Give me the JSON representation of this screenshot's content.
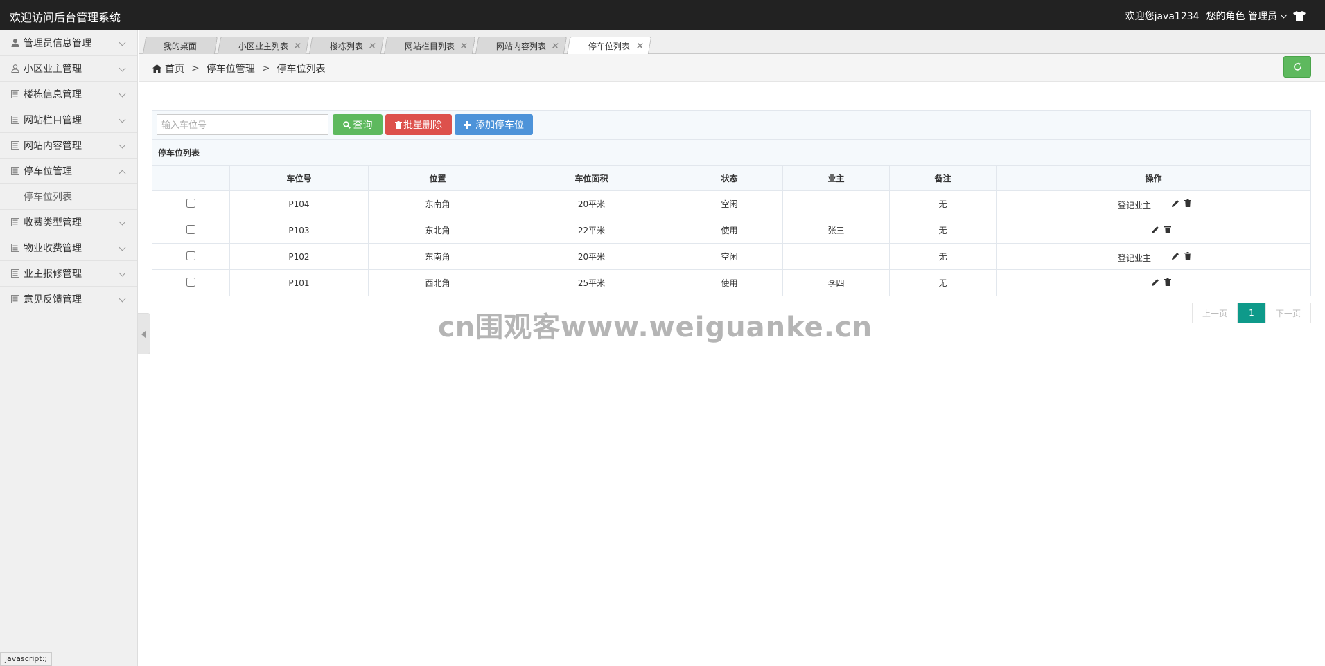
{
  "header": {
    "app_title": "欢迎访问后台管理系统",
    "welcome_user": "欢迎您java1234",
    "role_label": "您的角色 管理员"
  },
  "sidebar": {
    "items": [
      {
        "label": "管理员信息管理",
        "icon": "user-icon"
      },
      {
        "label": "小区业主管理",
        "icon": "user-outline-icon"
      },
      {
        "label": "楼栋信息管理",
        "icon": "list-icon"
      },
      {
        "label": "网站栏目管理",
        "icon": "list-icon"
      },
      {
        "label": "网站内容管理",
        "icon": "list-icon"
      },
      {
        "label": "停车位管理",
        "icon": "list-icon",
        "expanded": true
      },
      {
        "label": "收费类型管理",
        "icon": "list-icon"
      },
      {
        "label": "物业收费管理",
        "icon": "list-icon"
      },
      {
        "label": "业主报修管理",
        "icon": "list-icon"
      },
      {
        "label": "意见反馈管理",
        "icon": "list-icon"
      }
    ],
    "submenu_label": "停车位列表",
    "status_text": "javascript:;"
  },
  "tabs": [
    {
      "label": "我的桌面",
      "closable": false
    },
    {
      "label": "小区业主列表",
      "closable": true
    },
    {
      "label": "楼栋列表",
      "closable": true
    },
    {
      "label": "网站栏目列表",
      "closable": true
    },
    {
      "label": "网站内容列表",
      "closable": true
    },
    {
      "label": "停车位列表",
      "closable": true,
      "active": true
    }
  ],
  "breadcrumb": {
    "home": "首页",
    "sep": ">",
    "level1": "停车位管理",
    "level2": "停车位列表"
  },
  "toolbar": {
    "search_placeholder": "输入车位号",
    "search_button": "查询",
    "batch_delete_button": "批量删除",
    "add_button": "添加停车位"
  },
  "table": {
    "title": "停车位列表",
    "headers": [
      "",
      "车位号",
      "位置",
      "车位面积",
      "状态",
      "业主",
      "备注",
      "操作"
    ],
    "rows": [
      {
        "no": "P104",
        "location": "东南角",
        "area": "20平米",
        "status": "空闲",
        "owner": "",
        "remark": "无",
        "action": "登记业主"
      },
      {
        "no": "P103",
        "location": "东北角",
        "area": "22平米",
        "status": "使用",
        "owner": "张三",
        "remark": "无",
        "action": ""
      },
      {
        "no": "P102",
        "location": "东南角",
        "area": "20平米",
        "status": "空闲",
        "owner": "",
        "remark": "无",
        "action": "登记业主"
      },
      {
        "no": "P101",
        "location": "西北角",
        "area": "25平米",
        "status": "使用",
        "owner": "李四",
        "remark": "无",
        "action": ""
      }
    ]
  },
  "pager": {
    "prev": "上一页",
    "current": "1",
    "next": "下一页"
  },
  "watermark": "cn围观客www.weiguanke.cn",
  "colors": {
    "topbar": "#222222",
    "success": "#5eb95e",
    "danger": "#dd514c",
    "primary": "#4d93d9",
    "pager_active": "#0e9a8a"
  }
}
